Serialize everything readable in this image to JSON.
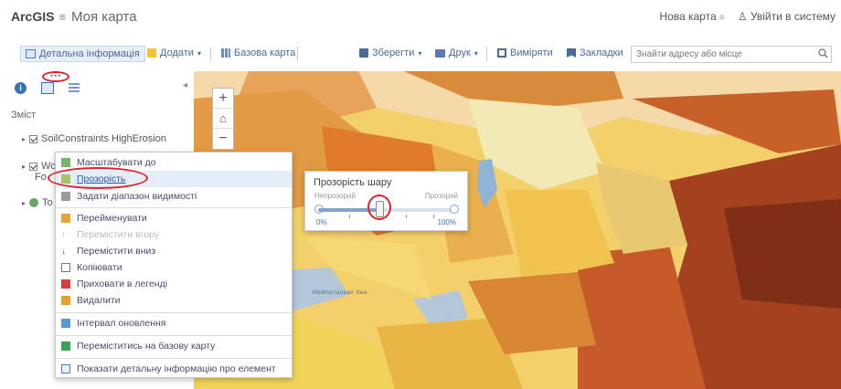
{
  "header": {
    "brand": "ArcGIS",
    "brand_menu_glyph": "≡",
    "map_title": "Моя карта",
    "new_map": "Нова карта",
    "new_map_glyph": "≡",
    "sign_in_glyph": "♙",
    "sign_in": "Увійти в систему"
  },
  "toolbar": {
    "details": "Детальна інформація",
    "add": "Додати",
    "add_glyph": "▾",
    "basemap": "Базова карта",
    "save": "Зберегти",
    "save_glyph": "▾",
    "print": "Друк",
    "print_glyph": "▾",
    "measure": "Виміряти",
    "bookmarks": "Закладки",
    "search_placeholder": "Знайти адресу або місце"
  },
  "panel": {
    "contents_label": "Зміст",
    "collapse_glyph": "◂",
    "expand_glyph": "▸",
    "more_glyph": "•••",
    "layers": [
      {
        "label": "SoilConstraints HighErosion"
      },
      {
        "label": "Wo"
      },
      {
        "label": "Fo"
      },
      {
        "label": "To"
      }
    ]
  },
  "map_controls": {
    "zoom_in": "+",
    "home_glyph": "⌂",
    "zoom_out": "−"
  },
  "context_menu": {
    "items": [
      {
        "label": "Масштабувати до",
        "state": "normal"
      },
      {
        "label": "Прозорість",
        "state": "active"
      },
      {
        "label": "Задати діапазон видимості",
        "state": "normal"
      },
      {
        "label": "Перейменувати",
        "state": "normal"
      },
      {
        "label": "Перемістити вгору",
        "state": "disabled"
      },
      {
        "label": "Перемістити вниз",
        "state": "normal"
      },
      {
        "label": "Копіювати",
        "state": "normal"
      },
      {
        "label": "Приховати в легенді",
        "state": "normal"
      },
      {
        "label": "Видалити",
        "state": "normal"
      },
      {
        "label": "Інтервал оновлення",
        "state": "normal"
      },
      {
        "label": "Переміститись на базову карту",
        "state": "normal"
      },
      {
        "label": "Показати детальну інформацію про елемент",
        "state": "normal"
      }
    ]
  },
  "transparency": {
    "title": "Прозорість шару",
    "opaque": "Непрозорий",
    "transparent": "Прозорий",
    "min": "0%",
    "max": "100%",
    "value_percent": 45
  },
  "map_labels": {
    "sea": "Mediterranean Sea"
  },
  "colors": {
    "accent": "#3a72b8",
    "highlight_ring": "#e0202c",
    "map_yellow": "#f3c94a",
    "map_orange": "#e48a2a",
    "map_brown": "#8a3a1e",
    "map_pale": "#f2e9b4"
  }
}
